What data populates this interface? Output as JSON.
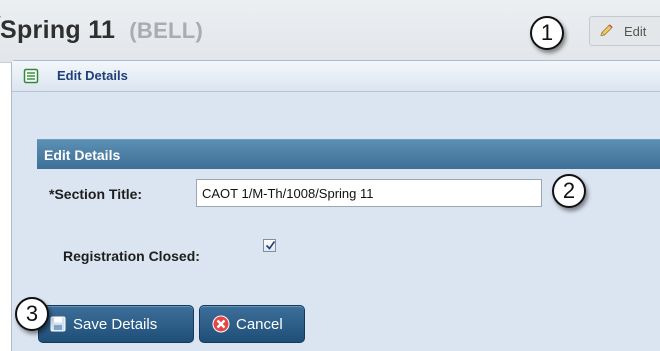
{
  "header": {
    "title": "Spring 11",
    "code": "(BELL)",
    "edit_label": "Edit"
  },
  "callouts": [
    "1",
    "2",
    "3"
  ],
  "panel": {
    "title": "Edit Details",
    "section_title": "Edit Details"
  },
  "form": {
    "section_title_label": "*Section Title:",
    "section_title_value": "CAOT 1/M-Th/1008/Spring 11",
    "registration_closed_label": "Registration Closed:",
    "registration_closed_checked": true
  },
  "buttons": {
    "save_label": "Save Details",
    "cancel_label": "Cancel"
  },
  "icons": {
    "edit": "pencil-icon",
    "panel": "document-icon",
    "save": "save-icon",
    "cancel": "cancel-icon",
    "checkbox": "check-icon"
  }
}
